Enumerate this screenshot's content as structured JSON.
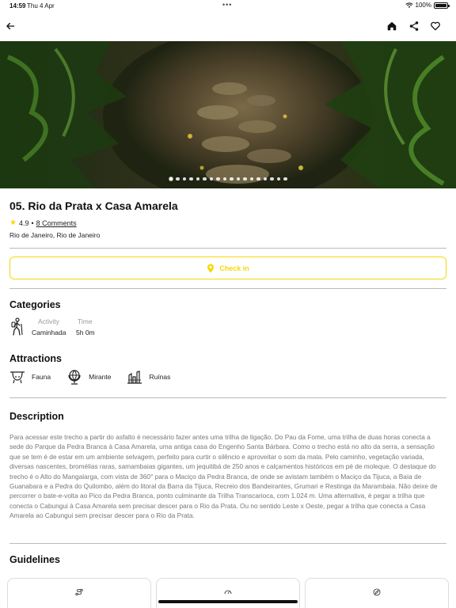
{
  "status": {
    "time": "14:59",
    "date": "Thu 4 Apr",
    "dots": "•••",
    "battery": "100%"
  },
  "nav": {
    "back_icon": "arrow-left-icon",
    "home_icon": "home-icon",
    "share_icon": "share-icon",
    "favorite_icon": "heart-icon"
  },
  "hero": {
    "slide_count": 18,
    "active_slide": 0
  },
  "trail": {
    "title": "05. Rio da Prata x Casa Amarela",
    "rating": "4.9",
    "separator": "•",
    "comments": "8 Comments",
    "location": "Rio de Janeiro, Rio de Janeiro"
  },
  "checkin": {
    "label": "Check in",
    "color": "#f5d90a"
  },
  "categories": {
    "title": "Categories",
    "activity_label": "Activity",
    "activity_value": "Caminhada",
    "time_label": "Time",
    "time_value": "5h 0m"
  },
  "attractions": {
    "title": "Attractions",
    "items": [
      {
        "label": "Fauna",
        "icon": "sloth-icon"
      },
      {
        "label": "Mirante",
        "icon": "globe-stand-icon"
      },
      {
        "label": "Ruínas",
        "icon": "ruins-icon"
      }
    ]
  },
  "description": {
    "title": "Description",
    "text": "Para acessar este trecho a partir do asfalto é necessário fazer antes uma trilha de ligação. Do Pau da Fome, uma trilha de duas horas conecta a sede do Parque da Pedra Branca à Casa Amarela, uma antiga casa do Engenho Santa Bárbara. Como o trecho está no alto da serra, a sensação que se tem é de estar em um ambiente selvagem, perfeito para curtir o silêncio e aproveitar o som da mata. Pelo caminho, vegetação variada, diversas nascentes, bromélias raras, samambaias gigantes, um jequitibá de 250 anos e calçamentos históricos em pé de moleque. O destaque do trecho é o Alto do Mangalarga, com vista de 360° para o Maciço da Pedra Branca, de onde se avistam também o Maciço da Tijuca, a Baía de Guanabara e a Pedra do Quilombo, além do litoral da Barra da Tijuca, Recreio dos Bandeirantes, Grumari e Restinga da Marambaia. Não deixe de percorrer o bate-e-volta ao Pico da Pedra Branca, ponto culminante da Trilha Transcarioca, com 1.024 m. Uma alternativa, é pegar a trilha que conecta o Cabungui à Casa Amarela sem precisar descer para o Rio da Prata. Ou no sentido Leste x Oeste, pegar a trilha que conecta a Casa Amarela ao Cabungui sem precisar descer para o Rio da Prata."
  },
  "guidelines": {
    "title": "Guidelines",
    "cards": [
      {
        "icon": "route-icon"
      },
      {
        "icon": "speedometer-icon"
      },
      {
        "icon": "compass-icon"
      }
    ]
  }
}
